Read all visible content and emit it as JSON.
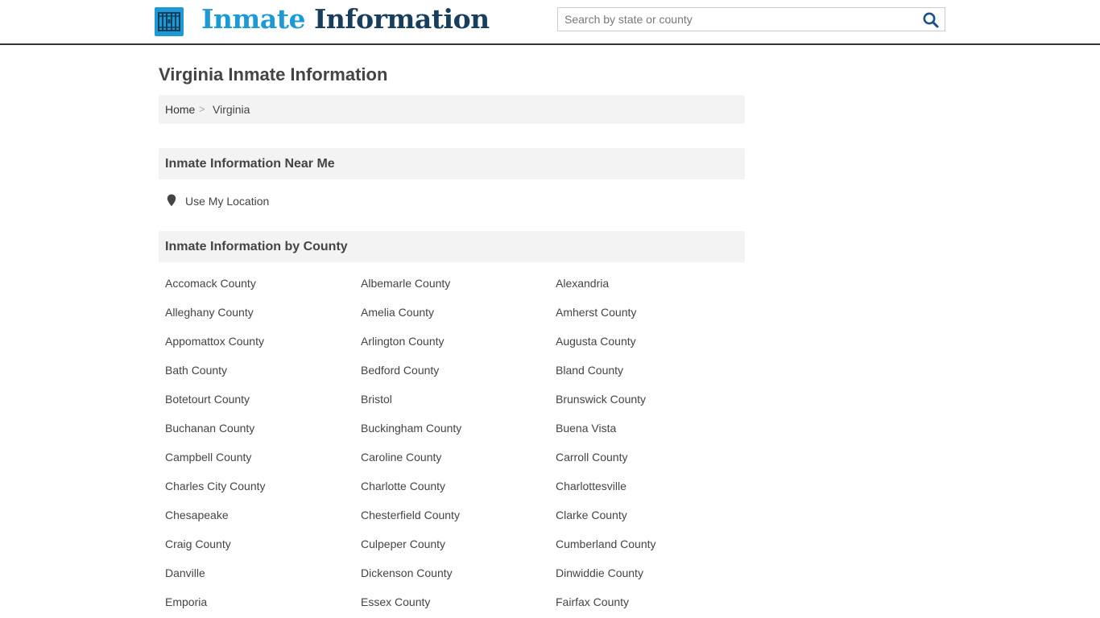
{
  "header": {
    "logo_word1": "Inmate",
    "logo_word2": "Information",
    "search_placeholder": "Search by state or county",
    "search_icon": "magnifier-icon",
    "logo_icon": "jail-cell-icon"
  },
  "colors": {
    "brand_light": "#1d9ad6",
    "brand_dark": "#173e5d",
    "panel_bg": "#f3f3f3"
  },
  "page": {
    "title": "Virginia Inmate Information"
  },
  "breadcrumb": {
    "home": "Home",
    "separator": ">",
    "current": "Virginia"
  },
  "near_me": {
    "heading": "Inmate Information Near Me",
    "use_location": "Use My Location",
    "icon": "map-pin-icon"
  },
  "by_county": {
    "heading": "Inmate Information by County",
    "counties": [
      "Accomack County",
      "Albemarle County",
      "Alexandria",
      "Alleghany County",
      "Amelia County",
      "Amherst County",
      "Appomattox County",
      "Arlington County",
      "Augusta County",
      "Bath County",
      "Bedford County",
      "Bland County",
      "Botetourt County",
      "Bristol",
      "Brunswick County",
      "Buchanan County",
      "Buckingham County",
      "Buena Vista",
      "Campbell County",
      "Caroline County",
      "Carroll County",
      "Charles City County",
      "Charlotte County",
      "Charlottesville",
      "Chesapeake",
      "Chesterfield County",
      "Clarke County",
      "Craig County",
      "Culpeper County",
      "Cumberland County",
      "Danville",
      "Dickenson County",
      "Dinwiddie County",
      "Emporia",
      "Essex County",
      "Fairfax County"
    ]
  }
}
